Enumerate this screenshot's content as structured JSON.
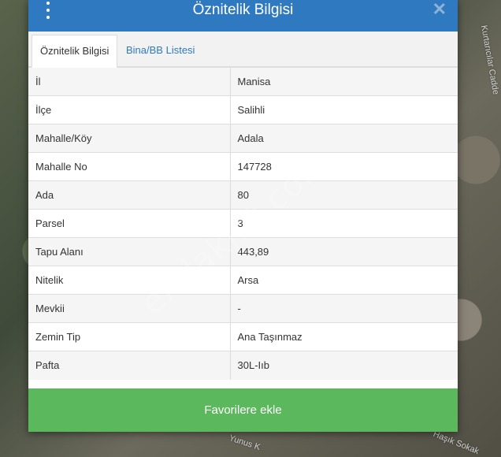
{
  "map": {
    "road_right": "Kurtarıcılar Cadde",
    "road_bottom_left": "Yunus K",
    "road_bottom_right": "Haşık Sokak",
    "watermark": "emlakjet.com"
  },
  "dialog": {
    "title": "Öznitelik Bilgisi",
    "close_label": "✕",
    "tabs": [
      {
        "label": "Öznitelik Bilgisi",
        "active": true
      },
      {
        "label": "Bina/BB Listesi",
        "active": false
      }
    ],
    "rows": [
      {
        "key": "İl",
        "value": "Manisa"
      },
      {
        "key": "İlçe",
        "value": "Salihli"
      },
      {
        "key": "Mahalle/Köy",
        "value": "Adala"
      },
      {
        "key": "Mahalle No",
        "value": "147728"
      },
      {
        "key": "Ada",
        "value": "80"
      },
      {
        "key": "Parsel",
        "value": "3"
      },
      {
        "key": "Tapu Alanı",
        "value": "443,89"
      },
      {
        "key": "Nitelik",
        "value": "Arsa"
      },
      {
        "key": "Mevkii",
        "value": "-"
      },
      {
        "key": "Zemin Tip",
        "value": "Ana Taşınmaz"
      },
      {
        "key": "Pafta",
        "value": "30L-Iıb"
      }
    ],
    "favorite_button": "Favorilere ekle"
  }
}
